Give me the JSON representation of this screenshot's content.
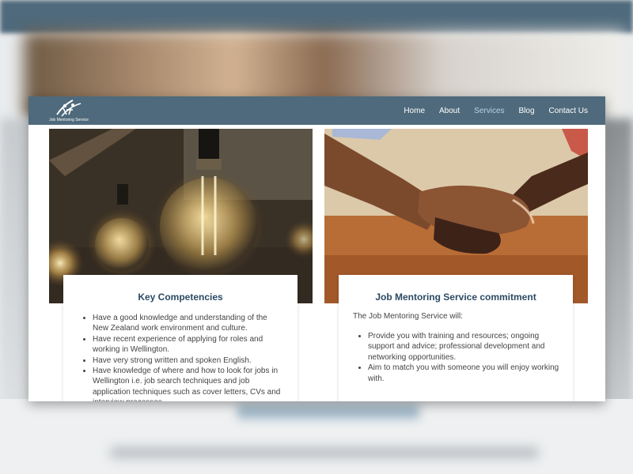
{
  "brand": {
    "logo_text": "Job Mentoring Service"
  },
  "nav": {
    "items": [
      {
        "label": "Home"
      },
      {
        "label": "About"
      },
      {
        "label": "Services"
      },
      {
        "label": "Blog"
      },
      {
        "label": "Contact Us"
      }
    ],
    "active": "Services"
  },
  "colors": {
    "navbar": "#4f6a7c",
    "active_nav": "#b8d3e6",
    "card_title": "#2b4a63"
  },
  "cards": [
    {
      "title": "Key Competencies",
      "intro": "",
      "items": [
        "Have a good knowledge and understanding of the New Zealand work environment and culture.",
        "Have recent experience of applying for roles and working in Wellington.",
        "Have very strong written and spoken English.",
        "Have knowledge of where and how to look for jobs in Wellington i.e. job search techniques and job application techniques such as cover letters, CVs and interview processes."
      ]
    },
    {
      "title": "Job Mentoring Service commitment",
      "intro": "The Job Mentoring Service will:",
      "items": [
        "Provide you with training and resources; ongoing support and advice; professional development and networking opportunities.",
        "Aim to match you with someone you will enjoy working with."
      ]
    }
  ],
  "images": {
    "left": "light-bulbs-photo",
    "right": "clasped-hands-photo"
  }
}
